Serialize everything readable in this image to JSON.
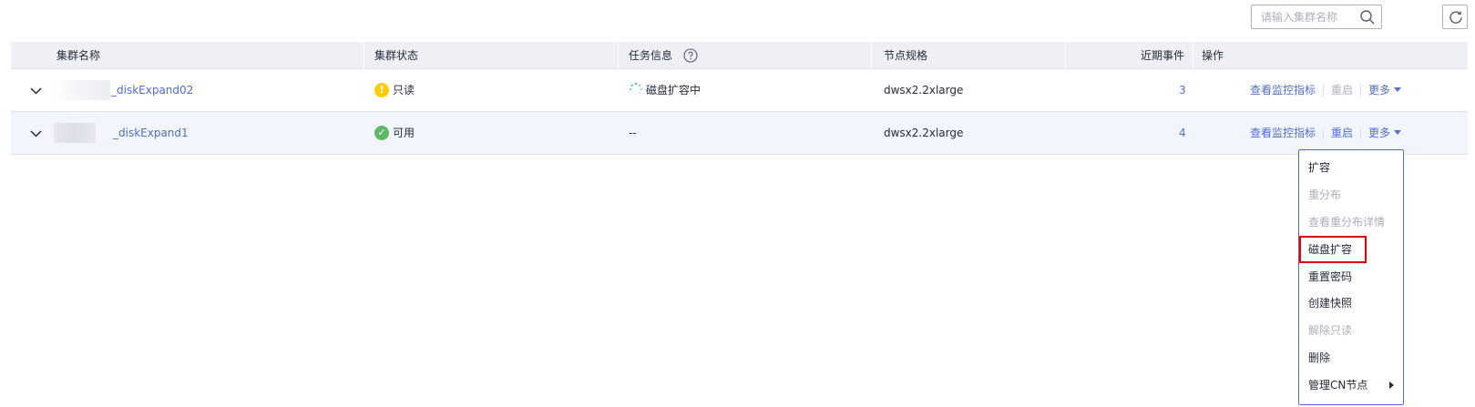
{
  "toolbar": {
    "search_placeholder": "请输入集群名称",
    "search_icon": "search-icon",
    "refresh_icon": "refresh-icon"
  },
  "table": {
    "columns": [
      "集群名称",
      "集群状态",
      "任务信息",
      "节点规格",
      "近期事件",
      "操作"
    ],
    "rows": [
      {
        "name": "_diskExpand02",
        "status": "只读",
        "status_color": "#ffcc00",
        "task": "磁盘扩容中",
        "spec": "dwsx2.2xlarge",
        "events": "3",
        "ops": {
          "monitor": "查看监控指标",
          "restart": "重启",
          "more": "更多"
        }
      },
      {
        "name": "_diskExpand1",
        "status": "可用",
        "status_color": "#5eb867",
        "task": "--",
        "spec": "dwsx2.2xlarge",
        "events": "4",
        "ops": {
          "monitor": "查看监控指标",
          "restart": "重启",
          "more": "更多"
        }
      }
    ]
  },
  "dropdown": {
    "items": [
      {
        "label": "扩容",
        "enabled": true
      },
      {
        "label": "重分布",
        "enabled": false
      },
      {
        "label": "查看重分布详情",
        "enabled": false
      },
      {
        "label": "磁盘扩容",
        "enabled": true
      },
      {
        "label": "重置密码",
        "enabled": true
      },
      {
        "label": "创建快照",
        "enabled": true
      },
      {
        "label": "解除只读",
        "enabled": false
      },
      {
        "label": "删除",
        "enabled": true
      },
      {
        "label": "管理CN节点",
        "enabled": true
      }
    ]
  },
  "colors": {
    "accent": "#526ecc",
    "header_bg": "#eef0f5",
    "row_hover_bg": "#f2f5fc",
    "highlight_box": "#e00000",
    "disabled_text": "#adb0b8"
  }
}
